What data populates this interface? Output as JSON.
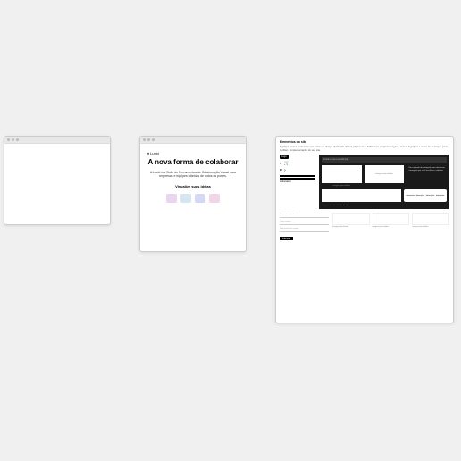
{
  "win2": {
    "logo": "♦ Lucid",
    "title": "A nova forma de colaborar",
    "desc": "A Lucid é a Suíte de Ferramentas de Colaboração Visual para empresas e equipes híbridas de todos os portes.",
    "cta": "Visualize suas ideias"
  },
  "win3": {
    "heading": "Elementos do site",
    "subheading": "Duplique esses conteúdos para criar um design detalhado da sua página web. Edite suas próprias imagens, textos, logotipos e cores de destaque para facilitar a implementação do seu site.",
    "tag": "Logo",
    "icons": {
      "search": "⌕",
      "cart": "🛒",
      "heart": "♥",
      "arrow": "›"
    },
    "caption": "Lubomasks",
    "search_placeholder": "Avalie a sua experiência",
    "img_label": "imagem placeholder",
    "img_center": "Imagem placeholder",
    "para": "Um exemplo de parágrafo para descrever a imagem que você escolheu e adaptar.",
    "pills": "Interação · Interação · Interação · Interação",
    "small_box_label": "Imagem de item da lista de itens",
    "field1": "Nome do campo",
    "field2": "Outro campo",
    "field3": "Informação de campo",
    "card_label": "Imagem placeholder",
    "btn": "Interação"
  }
}
